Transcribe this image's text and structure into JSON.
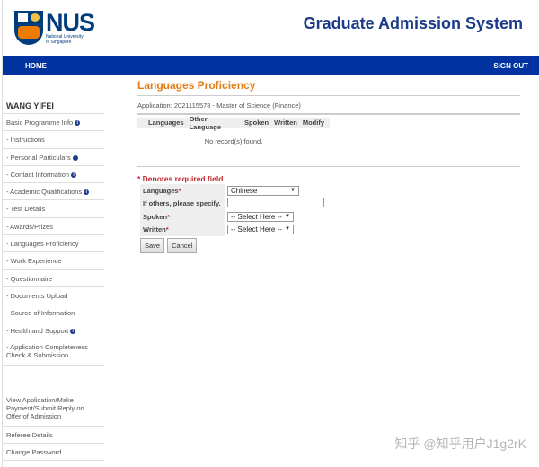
{
  "header": {
    "logo_text": "NUS",
    "logo_sub1": "National University",
    "logo_sub2": "of Singapore",
    "system_title": "Graduate Admission System"
  },
  "nav": {
    "home": "HOME",
    "sign_out": "SIGN OUT"
  },
  "sidebar": {
    "user": "WANG YIFEI",
    "items": [
      {
        "label": "Basic Programme Info",
        "info": true
      },
      {
        "label": "- Instructions",
        "info": false
      },
      {
        "label": "- Personal Particulars",
        "info": true
      },
      {
        "label": "- Contact Information",
        "info": true
      },
      {
        "label": "- Academic Qualifications",
        "info": true
      },
      {
        "label": "- Test Details",
        "info": false
      },
      {
        "label": "- Awards/Prizes",
        "info": false
      },
      {
        "label": "- Languages Proficiency",
        "info": false
      },
      {
        "label": "- Work Experience",
        "info": false
      },
      {
        "label": "- Questionnaire",
        "info": false
      },
      {
        "label": "- Documents Upload",
        "info": false
      },
      {
        "label": "- Source of Information",
        "info": false
      },
      {
        "label": "- Health and Support",
        "info": true
      },
      {
        "label": "- Application Completeness Check & Submission",
        "info": false
      }
    ],
    "bottom_items": [
      "View Application/Make Payment/Submit Reply on Offer of Admission",
      "Referee Details",
      "Change Password"
    ]
  },
  "main": {
    "title": "Languages Proficiency",
    "application": "Application: 2021115578 - Master of Science (Finance)",
    "columns": [
      "Languages",
      "Other Language",
      "Spoken",
      "Written",
      "Modify"
    ],
    "empty": "No record(s) found.",
    "required_note": "* Denotes required field",
    "form": {
      "languages_label": "Languages",
      "languages_value": "Chinese",
      "others_label": "If others, please specify.",
      "others_value": "",
      "spoken_label": "Spoken",
      "spoken_value": "-- Select Here --",
      "written_label": "Written",
      "written_value": "-- Select Here --",
      "star": "*"
    },
    "save": "Save",
    "cancel": "Cancel"
  },
  "watermark": "知乎 @知乎用户J1g2rK",
  "colors": {
    "nav": "#0033a0",
    "title": "#e07b16",
    "required": "#c1272d",
    "brand": "#003d7c"
  }
}
